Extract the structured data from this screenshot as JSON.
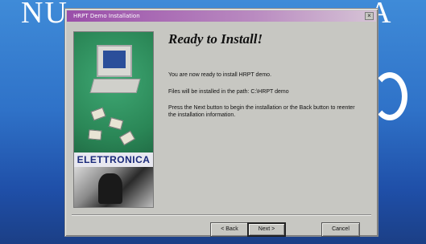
{
  "background": {
    "title_left": "NU",
    "title_right": "A"
  },
  "dialog": {
    "title": "HRPT Demo Installation",
    "close_glyph": "×",
    "heading": "Ready to Install!",
    "paragraphs": [
      "You are now ready to install HRPT demo.",
      "Files will be installed in the path: C:\\HRPT demo",
      "Press the Next button to begin the installation or the Back button to reenter the installation information."
    ],
    "logo_text": "ELETTRONICA",
    "buttons": {
      "back": "< Back",
      "next": "Next >",
      "cancel": "Cancel"
    }
  }
}
